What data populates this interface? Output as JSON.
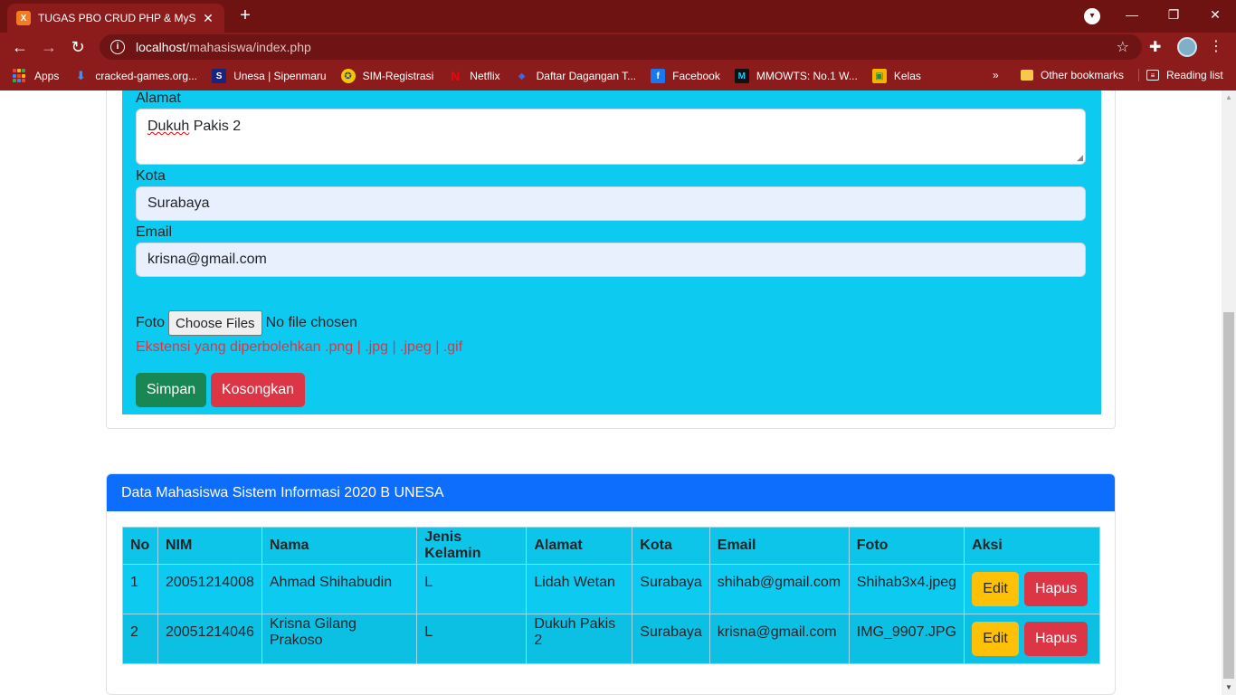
{
  "browser": {
    "tab_title": "TUGAS PBO CRUD PHP & MySQL",
    "tab_favicon_text": "X",
    "url_host": "localhost",
    "url_path": "/mahasiswa/index.php",
    "bookmarks": [
      {
        "label": "Apps",
        "icon": "apps-grid-icon"
      },
      {
        "label": "cracked-games.org...",
        "icon": "download-arrow-icon",
        "color": "#4a90e2",
        "glyph": "⬇"
      },
      {
        "label": "Unesa | Sipenmaru",
        "icon": "s-logo-icon",
        "color": "#1a237e",
        "glyph": "S"
      },
      {
        "label": "SIM-Registrasi",
        "icon": "unesa-seal-icon",
        "color": "#1f4fa0",
        "glyph": "✪"
      },
      {
        "label": "Netflix",
        "icon": "netflix-icon",
        "color": "#e50914",
        "glyph": "N"
      },
      {
        "label": "Daftar Dagangan T...",
        "icon": "tag-icon",
        "color": "#2f6ee8",
        "glyph": "◆"
      },
      {
        "label": "Facebook",
        "icon": "facebook-icon",
        "color": "#1877f2",
        "glyph": "f"
      },
      {
        "label": "MMOWTS: No.1 W...",
        "icon": "m-logo-icon",
        "color": "#111111",
        "glyph": "M"
      },
      {
        "label": "Kelas",
        "icon": "classroom-icon",
        "color": "#f6b400",
        "glyph": "▣"
      }
    ],
    "overflow_chevron": "»",
    "other_bookmarks": "Other bookmarks",
    "reading_list": "Reading list"
  },
  "form": {
    "alamat_label": "Alamat",
    "alamat_value_word1": "Dukuh",
    "alamat_value_rest": " Pakis 2",
    "kota_label": "Kota",
    "kota_value": "Surabaya",
    "email_label": "Email",
    "email_value": "krisna@gmail.com",
    "foto_label": "Foto",
    "file_button": "Choose Files",
    "file_status": "No file chosen",
    "hint": "Ekstensi yang diperbolehkan .png | .jpg | .jpeg | .gif",
    "save_button": "Simpan",
    "reset_button": "Kosongkan"
  },
  "table_card": {
    "title": "Data Mahasiswa Sistem Informasi 2020 B UNESA",
    "headers": [
      "No",
      "NIM",
      "Nama",
      "Jenis Kelamin",
      "Alamat",
      "Kota",
      "Email",
      "Foto",
      "Aksi"
    ],
    "rows": [
      {
        "no": "1",
        "nim": "20051214008",
        "nama": "Ahmad Shihabudin",
        "jk": "L",
        "alamat": "Lidah Wetan",
        "kota": "Surabaya",
        "email": "shihab@gmail.com",
        "foto": "Shihab3x4.jpeg"
      },
      {
        "no": "2",
        "nim": "20051214046",
        "nama": "Krisna Gilang Prakoso",
        "jk": "L",
        "alamat": "Dukuh Pakis 2",
        "kota": "Surabaya",
        "email": "krisna@gmail.com",
        "foto": "IMG_9907.JPG"
      }
    ],
    "edit_label": "Edit",
    "delete_label": "Hapus"
  },
  "colors": {
    "chrome": "#8c1b1b",
    "form_bg": "#0dcaf0",
    "header_blue": "#0d6efd",
    "success": "#198754",
    "danger": "#dc3545",
    "warning": "#ffc107"
  }
}
